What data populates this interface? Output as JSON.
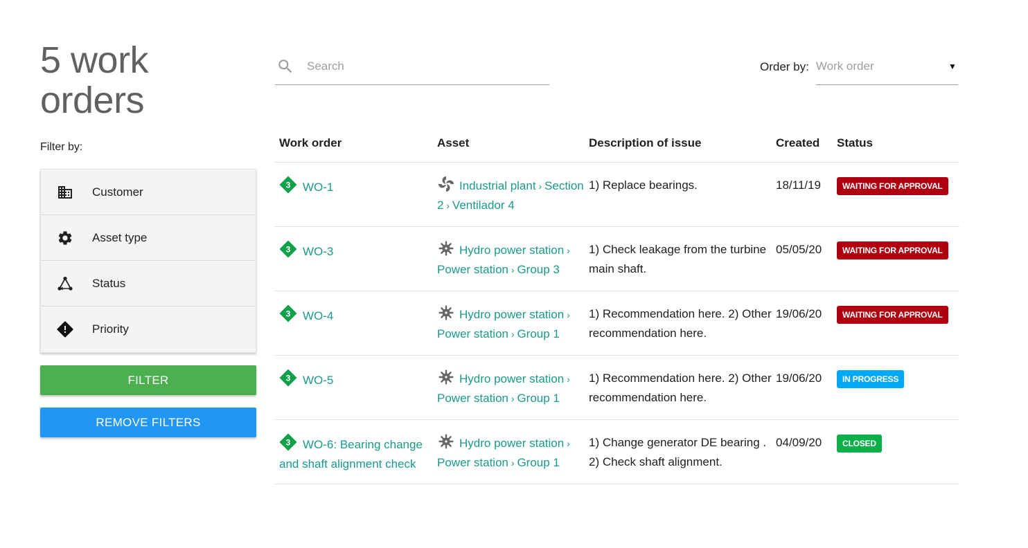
{
  "page": {
    "title": "5 work orders",
    "filter_label": "Filter by:"
  },
  "filters": [
    {
      "label": "Customer",
      "icon": "building-icon"
    },
    {
      "label": "Asset type",
      "icon": "gear-icon"
    },
    {
      "label": "Status",
      "icon": "workflow-icon"
    },
    {
      "label": "Priority",
      "icon": "warning-diamond-icon"
    }
  ],
  "buttons": {
    "filter": "FILTER",
    "remove_filters": "REMOVE FILTERS"
  },
  "search": {
    "placeholder": "Search",
    "value": ""
  },
  "order_by": {
    "label": "Order by:",
    "selected": "Work order"
  },
  "colors": {
    "accent_link": "#1a9a8a",
    "priority_green": "#12a14b",
    "filter_button": "#4caf50",
    "remove_button": "#2196f3",
    "waiting": "#b0000f",
    "in_progress": "#03a9f4",
    "closed": "#0bb04a"
  },
  "table": {
    "headers": [
      "Work order",
      "Asset",
      "Description of issue",
      "Created",
      "Status"
    ],
    "rows": [
      {
        "priority": "3",
        "work_order": "WO-1",
        "asset_icon": "fan-icon",
        "asset_path": [
          "Industrial plant",
          "Section 2",
          "Ventilador 4"
        ],
        "description": "1) Replace bearings.",
        "created": "18/11/19",
        "status": "WAITING FOR APPROVAL",
        "status_color": "#b0000f"
      },
      {
        "priority": "3",
        "work_order": "WO-3",
        "asset_icon": "turbine-icon",
        "asset_path": [
          "Hydro power station",
          "Power station",
          "Group 3"
        ],
        "description": "1) Check leakage from the turbine main shaft.",
        "created": "05/05/20",
        "status": "WAITING FOR APPROVAL",
        "status_color": "#b0000f"
      },
      {
        "priority": "3",
        "work_order": "WO-4",
        "asset_icon": "turbine-icon",
        "asset_path": [
          "Hydro power station",
          "Power station",
          "Group 1"
        ],
        "description": "1) Recommendation here. 2) Other recommendation here.",
        "created": "19/06/20",
        "status": "WAITING FOR APPROVAL",
        "status_color": "#b0000f"
      },
      {
        "priority": "3",
        "work_order": "WO-5",
        "asset_icon": "turbine-icon",
        "asset_path": [
          "Hydro power station",
          "Power station",
          "Group 1"
        ],
        "description": "1) Recommendation here. 2) Other recommendation here.",
        "created": "19/06/20",
        "status": "IN PROGRESS",
        "status_color": "#03a9f4"
      },
      {
        "priority": "3",
        "work_order": "WO-6: Bearing change and shaft alignment check",
        "asset_icon": "turbine-icon",
        "asset_path": [
          "Hydro power station",
          "Power station",
          "Group 1"
        ],
        "description": "1) Change generator DE bearing . 2) Check shaft alignment.",
        "created": "04/09/20",
        "status": "CLOSED",
        "status_color": "#0bb04a"
      }
    ]
  }
}
